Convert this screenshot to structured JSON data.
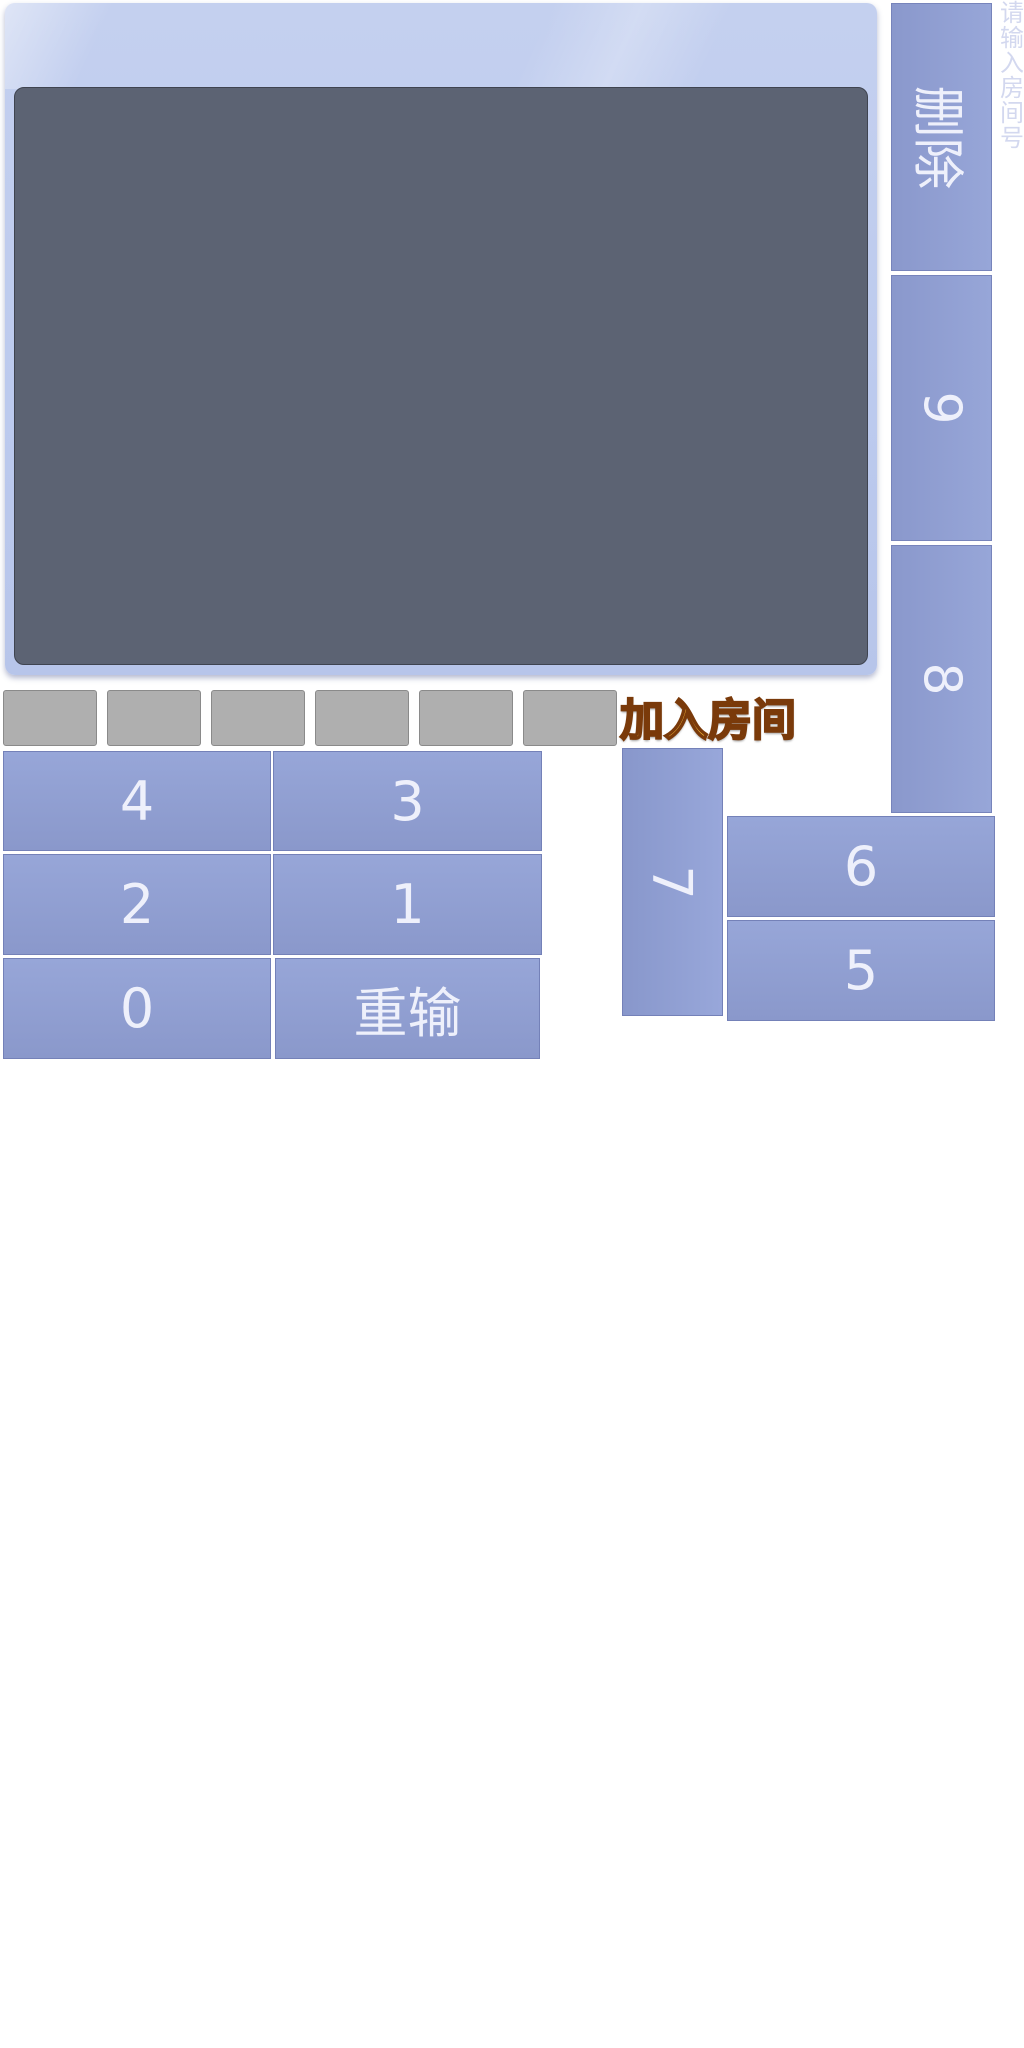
{
  "hint": {
    "text": "请输入房间号"
  },
  "buttons": {
    "delete": "删除",
    "reset": "重输",
    "join_room": "加入房间"
  },
  "keypad": {
    "k0": "0",
    "k1": "1",
    "k2": "2",
    "k3": "3",
    "k4": "4",
    "k5": "5",
    "k6": "6",
    "k7": "7",
    "k8": "8",
    "k9": "9"
  },
  "room_code_slots": [
    "",
    "",
    "",
    "",
    "",
    ""
  ],
  "colors": {
    "panel": "#c4d0ef",
    "screen": "#5c6373",
    "key": "#8f9ed3",
    "slot": "#afafaf",
    "join_text": "#f7b93a"
  }
}
